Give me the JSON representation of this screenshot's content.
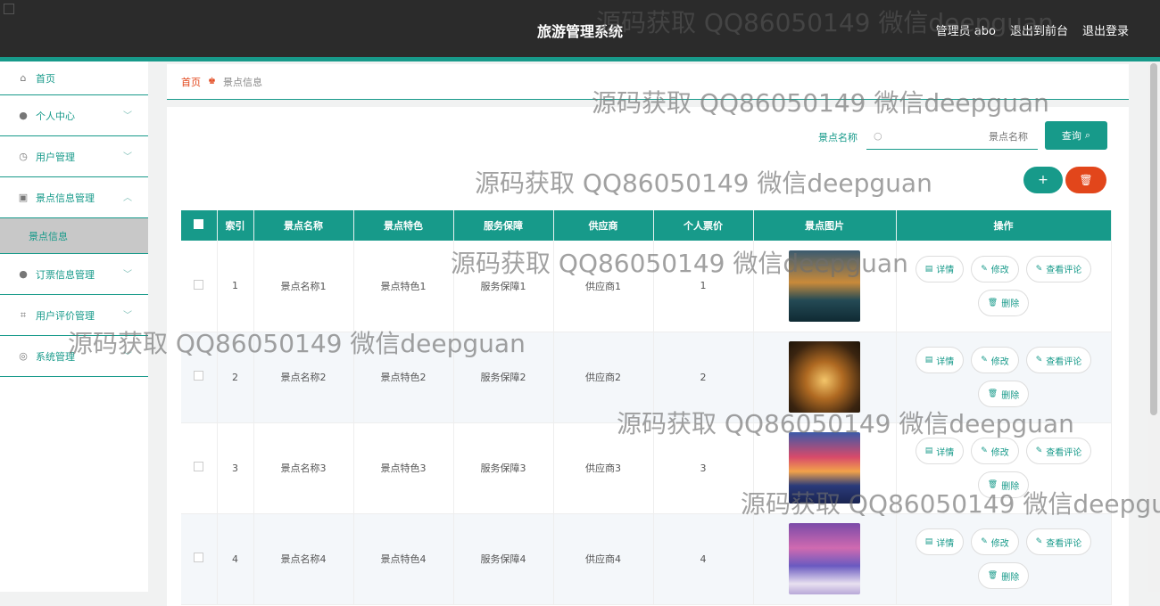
{
  "header": {
    "title": "旅游管理系统",
    "admin": "管理员 abo",
    "back_front": "退出到前台",
    "logout": "退出登录"
  },
  "sidebar": {
    "items": [
      {
        "label": "首页",
        "icon": "home-icon"
      },
      {
        "label": "个人中心",
        "icon": "user-icon"
      },
      {
        "label": "用户管理",
        "icon": "clock-icon"
      },
      {
        "label": "景点信息管理",
        "icon": "clipboard-icon"
      },
      {
        "label": "订票信息管理",
        "icon": "bulb-icon"
      },
      {
        "label": "用户评价管理",
        "icon": "crop-icon"
      },
      {
        "label": "系统管理",
        "icon": "compass-icon"
      }
    ],
    "sub_active": "景点信息"
  },
  "breadcrumb": {
    "home": "首页",
    "current": "景点信息"
  },
  "search": {
    "label": "景点名称",
    "placeholder": "景点名称",
    "button": "查询"
  },
  "table": {
    "headers": [
      "索引",
      "景点名称",
      "景点特色",
      "服务保障",
      "供应商",
      "个人票价",
      "景点图片",
      "操作"
    ],
    "rows": [
      {
        "index": "1",
        "name": "景点名称1",
        "feature": "景点特色1",
        "service": "服务保障1",
        "supplier": "供应商1",
        "price": "1"
      },
      {
        "index": "2",
        "name": "景点名称2",
        "feature": "景点特色2",
        "service": "服务保障2",
        "supplier": "供应商2",
        "price": "2"
      },
      {
        "index": "3",
        "name": "景点名称3",
        "feature": "景点特色3",
        "service": "服务保障3",
        "supplier": "供应商3",
        "price": "3"
      },
      {
        "index": "4",
        "name": "景点名称4",
        "feature": "景点特色4",
        "service": "服务保障4",
        "supplier": "供应商4",
        "price": "4"
      }
    ],
    "ops": {
      "detail": "详情",
      "edit": "修改",
      "review": "查看评论",
      "delete": "删除"
    }
  },
  "watermark": "源码获取 QQ86050149 微信deepguan",
  "colors": {
    "accent": "#179a8a",
    "danger": "#e2461b",
    "topbar": "#2b2b2b"
  }
}
